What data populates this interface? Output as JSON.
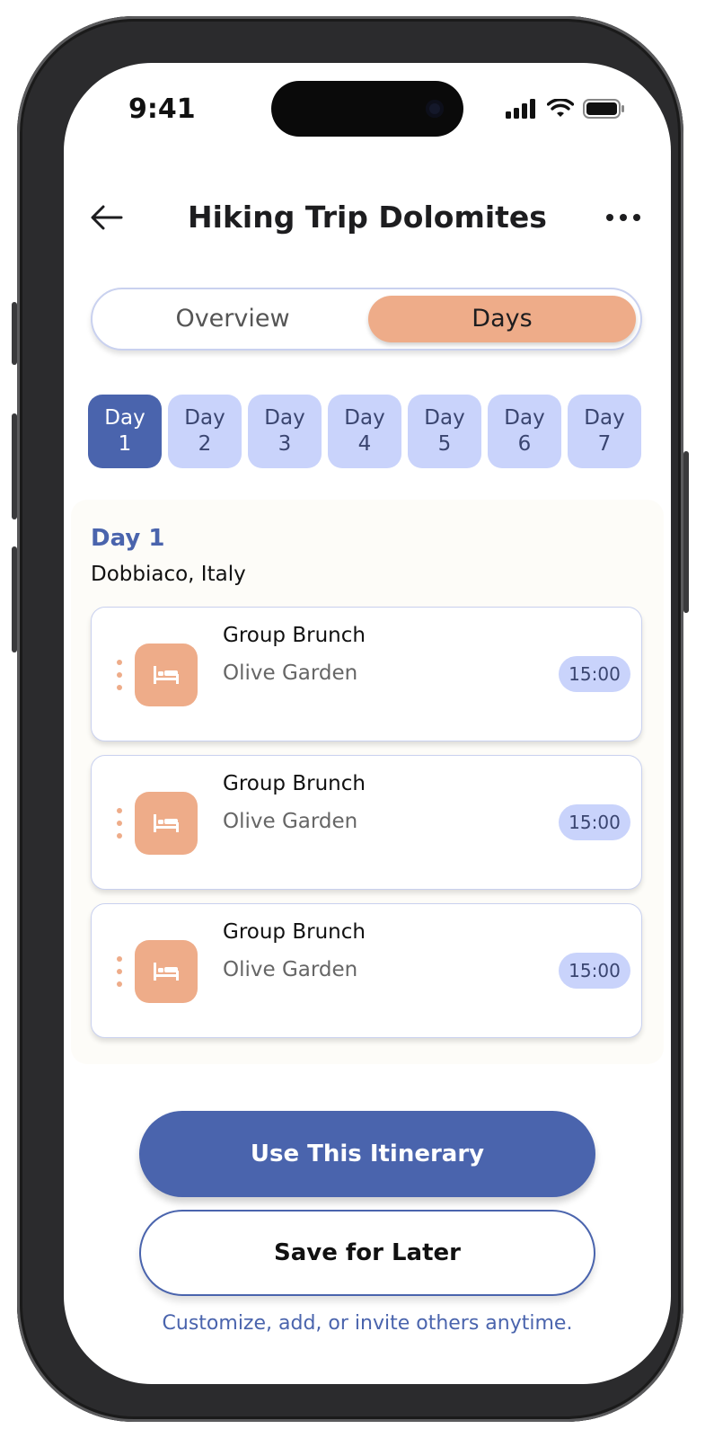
{
  "status_bar": {
    "time": "9:41"
  },
  "header": {
    "title": "Hiking Trip Dolomites"
  },
  "tabs": [
    {
      "label": "Overview",
      "selected": false
    },
    {
      "label": "Days",
      "selected": true
    }
  ],
  "days": [
    {
      "line1": "Day",
      "line2": "1",
      "selected": true
    },
    {
      "line1": "Day",
      "line2": "2",
      "selected": false
    },
    {
      "line1": "Day",
      "line2": "3",
      "selected": false
    },
    {
      "line1": "Day",
      "line2": "4",
      "selected": false
    },
    {
      "line1": "Day",
      "line2": "5",
      "selected": false
    },
    {
      "line1": "Day",
      "line2": "6",
      "selected": false
    },
    {
      "line1": "Day",
      "line2": "7",
      "selected": false
    }
  ],
  "day_detail": {
    "heading": "Day 1",
    "location": "Dobbiaco, Italy",
    "activities": [
      {
        "title": "Group Brunch",
        "subtitle": "Olive Garden",
        "time": "15:00",
        "icon": "bed-icon"
      },
      {
        "title": "Group Brunch",
        "subtitle": "Olive Garden",
        "time": "15:00",
        "icon": "bed-icon"
      },
      {
        "title": "Group Brunch",
        "subtitle": "Olive Garden",
        "time": "15:00",
        "icon": "bed-icon"
      }
    ]
  },
  "actions": {
    "primary_label": "Use This Itinerary",
    "secondary_label": "Save for Later",
    "helper_text": "Customize, add, or invite others anytime."
  },
  "colors": {
    "accent_blue": "#4a64ad",
    "chip_blue": "#c9d3fb",
    "accent_peach": "#eeac89"
  }
}
